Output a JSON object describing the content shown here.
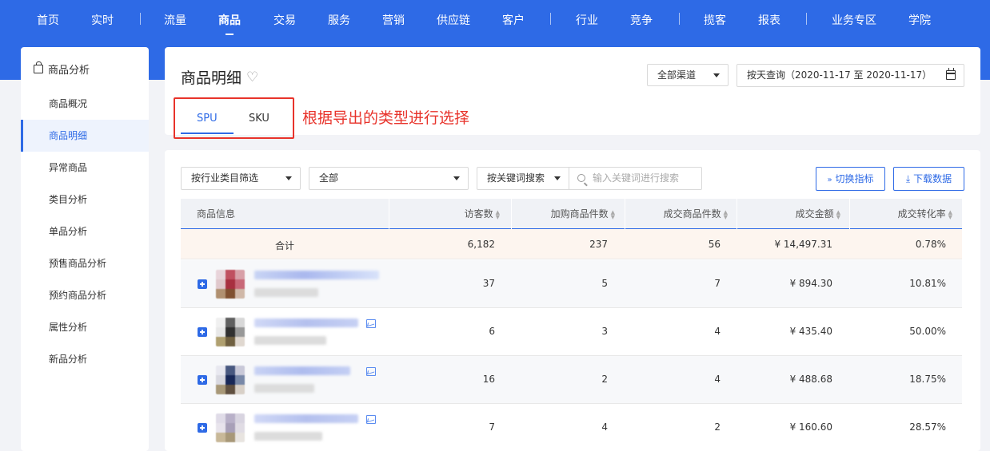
{
  "nav": {
    "items": [
      "首页",
      "实时",
      "流量",
      "商品",
      "交易",
      "服务",
      "营销",
      "供应链",
      "客户",
      "行业",
      "竞争",
      "揽客",
      "报表",
      "业务专区",
      "学院"
    ],
    "active": "商品"
  },
  "sidebar": {
    "title": "商品分析",
    "items": [
      "商品概况",
      "商品明细",
      "异常商品",
      "类目分析",
      "单品分析",
      "预售商品分析",
      "预约商品分析",
      "属性分析",
      "新品分析"
    ],
    "active": "商品明细"
  },
  "header": {
    "title": "商品明细",
    "channel": "全部渠道",
    "date_query": "按天查询（2020-11-17 至 2020-11-17）",
    "tabs": [
      "SPU",
      "SKU"
    ],
    "active_tab": "SPU",
    "annotation": "根据导出的类型进行选择"
  },
  "filters": {
    "category_filter": "按行业类目筛选",
    "all": "全部",
    "keyword_search": "按关键词搜索",
    "search_placeholder": "输入关键词进行搜索",
    "switch_metrics": "切换指标",
    "download": "下载数据"
  },
  "table": {
    "columns": [
      "商品信息",
      "访客数",
      "加购商品件数",
      "成交商品件数",
      "成交金额",
      "成交转化率"
    ],
    "total": {
      "label": "合计",
      "visitors": "6,182",
      "cart": "237",
      "sold": "56",
      "amount": "¥ 14,497.31",
      "rate": "0.78%"
    },
    "rows": [
      {
        "visitors": "37",
        "cart": "5",
        "sold": "7",
        "amount": "¥ 894.30",
        "rate": "10.81%"
      },
      {
        "visitors": "6",
        "cart": "3",
        "sold": "4",
        "amount": "¥ 435.40",
        "rate": "50.00%"
      },
      {
        "visitors": "16",
        "cart": "2",
        "sold": "4",
        "amount": "¥ 488.68",
        "rate": "18.75%"
      },
      {
        "visitors": "7",
        "cart": "4",
        "sold": "2",
        "amount": "¥ 160.60",
        "rate": "28.57%"
      }
    ]
  },
  "colors": {
    "primary": "#2e6ae6",
    "annotation": "#e8332b",
    "total_row_bg": "#fdf5ef"
  }
}
